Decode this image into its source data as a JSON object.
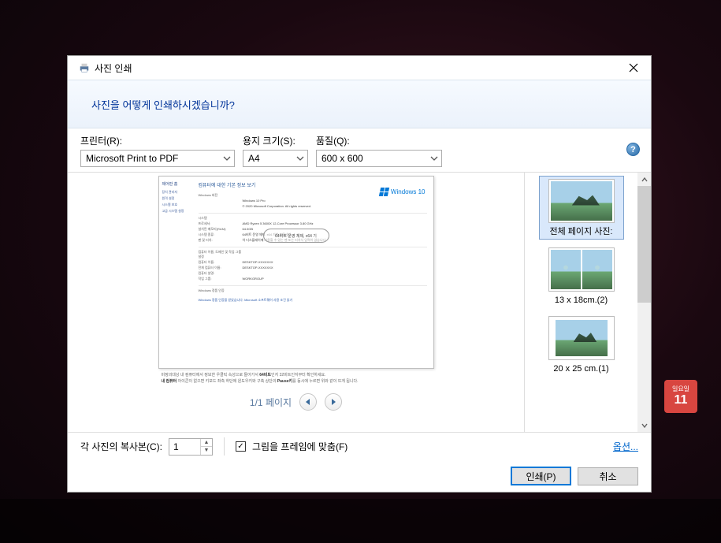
{
  "desktop": {
    "calendar_day": "일요일",
    "calendar_date": "11"
  },
  "titlebar": {
    "title": "사진 인쇄"
  },
  "header": {
    "prompt": "사진을 어떻게 인쇄하시겠습니까?"
  },
  "options": {
    "printer": {
      "label": "프린터(R):",
      "value": "Microsoft Print to PDF"
    },
    "paper": {
      "label": "용지 크기(S):",
      "value": "A4"
    },
    "quality": {
      "label": "품질(Q):",
      "value": "600 x 600"
    },
    "help": "?"
  },
  "preview": {
    "page_title": "컴퓨터에 대한 기본 정보 보기",
    "side_header": "제어판 홈",
    "side_items": [
      "장치 관리자",
      "원격 설정",
      "시스템 보호",
      "고급 시스템 설정"
    ],
    "edition_label": "Windows 버전",
    "edition1": "Windows 10 Pro",
    "edition2": "© 2020 Microsoft Corporation. All rights reserved.",
    "logo_text": "Windows 10",
    "sys_header": "시스템",
    "sys_rows": [
      {
        "k": "프로세서:",
        "v": "AMD Ryzen 5 3600X 12-Core Processor    3.80 GHz"
      },
      {
        "k": "설치된 메모리(RAM):",
        "v": "64.0GB"
      },
      {
        "k": "시스템 종류:",
        "v": "64비트 운영 체제, x64 기반 프로세서"
      },
      {
        "k": "펜 및 터치:",
        "v": "이 디스플레이에 사용할 수 있는 펜 또는 터치식 입력이 없습니다."
      }
    ],
    "name_header": "컴퓨터 이름, 도메인 및 작업 그룹 설정",
    "name_rows": [
      {
        "k": "컴퓨터 이름:",
        "v": "DESKTOP-XXXXXXX"
      },
      {
        "k": "전체 컴퓨터 이름:",
        "v": "DESKTOP-XXXXXXX"
      },
      {
        "k": "컴퓨터 설명:",
        "v": ""
      },
      {
        "k": "작업 그룹:",
        "v": "WORKGROUP"
      }
    ],
    "act_header": "Windows 정품 인증",
    "act_line": "Windows 정품 인증을 받았습니다.  Microsoft 소프트웨어 사용 조건 읽기",
    "annotation": "64비트 운영 체제, x64 기",
    "footnote1a": "비정의대상 내 컴퓨터",
    "footnote1b": "에서 정보한 우클릭 속성으로 들어가서 ",
    "footnote1c": "64비트",
    "footnote1d": "인지 32비트인지부터 확인하세요.",
    "footnote2a": "내 컴퓨터",
    "footnote2b": " 아이콘이 없으면 키보드 좌측 하단에 윈도우키와 구축 상단의 ",
    "footnote2c": "Pause키",
    "footnote2d": "를 동시에 누르면 위와 같이 뜨게 됩니다.",
    "pager": "1/1 페이지"
  },
  "layouts": [
    {
      "label": "전체 페이지 사진:"
    },
    {
      "label": "13 x 18cm.(2)"
    },
    {
      "label": "20 x 25 cm.(1)"
    }
  ],
  "footer": {
    "copies_label": "각 사진의 복사본(C):",
    "copies_value": "1",
    "fit_label": "그림을 프레임에 맞춤(F)",
    "fit_checked": "✓",
    "options_link": "옵션...",
    "print_btn": "인쇄(P)",
    "cancel_btn": "취소"
  }
}
